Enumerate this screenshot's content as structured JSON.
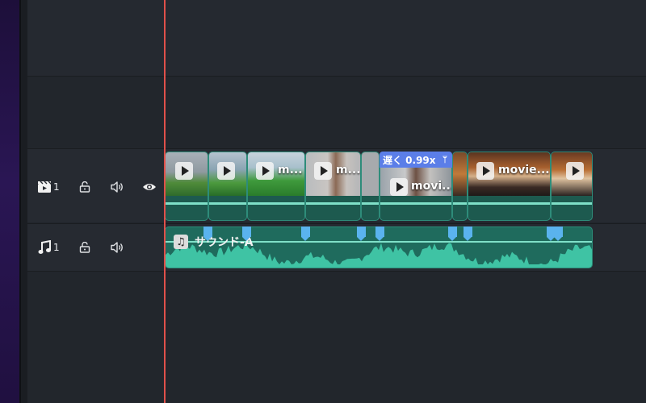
{
  "tracks": {
    "video": {
      "number": "1"
    },
    "audio": {
      "number": "1"
    }
  },
  "video_clips": [
    {
      "label": ""
    },
    {
      "label": ""
    },
    {
      "label": "m..."
    },
    {
      "label": "m..."
    },
    {
      "label": ""
    },
    {
      "label": "movi..."
    },
    {
      "label": ""
    },
    {
      "label": "movie..."
    },
    {
      "label": ""
    }
  ],
  "speed_tag": "遅く 0.99x",
  "audio_clip": {
    "title": "サウンド-A"
  },
  "colors": {
    "accent_teal": "#7fe0c8",
    "playhead": "#e0504a",
    "marker": "#5ab3ee",
    "speed_tag": "#5b7ee8"
  },
  "icons": [
    "video-track-icon",
    "lock-icon",
    "speaker-icon",
    "eye-icon",
    "music-note-icon",
    "play-icon"
  ]
}
